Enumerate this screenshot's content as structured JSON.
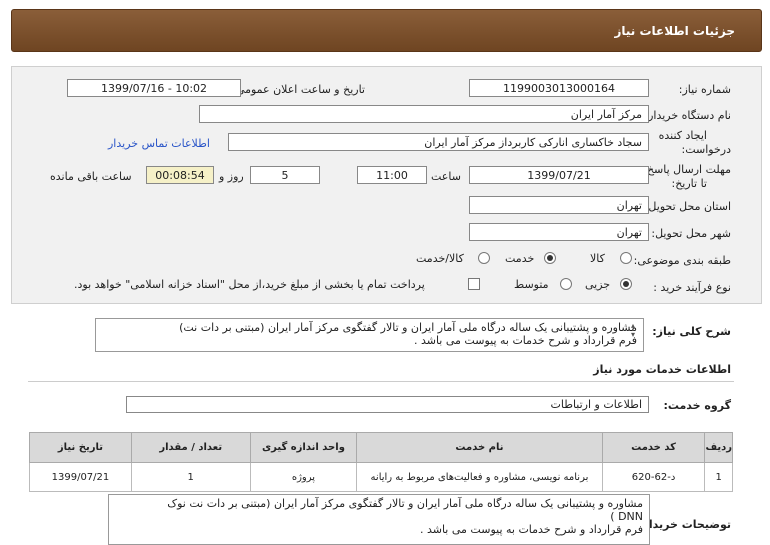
{
  "header": {
    "title": "جزئیات اطلاعات نیاز"
  },
  "form": {
    "need_number_label": "شماره نیاز:",
    "need_number": "1199003013000164",
    "announce_label": "تاریخ و ساعت اعلان عمومی:",
    "announce_value": "1399/07/16 - 10:02",
    "buyer_label": "نام دستگاه خریدار:",
    "buyer_value": "مرکز آمار ایران",
    "creator_label_1": "ایجاد کننده",
    "creator_label_2": "درخواست:",
    "creator_value": "سجاد خاکساری انارکی کاربرداز مرکز آمار ایران",
    "contact_link": "اطلاعات تماس خریدار",
    "deadline_label_1": "مهلت ارسال پاسخ:",
    "deadline_label_2": "تا تاریخ:",
    "deadline_date": "1399/07/21",
    "time_label": "ساعت",
    "deadline_time": "11:00",
    "days_value": "5",
    "days_label": "روز و",
    "remaining_value": "00:08:54",
    "remaining_label": "ساعت باقی مانده",
    "province_label": "استان محل تحویل:",
    "province_value": "تهران",
    "city_label": "شهر محل تحویل:",
    "city_value": "تهران",
    "category_label": "طبقه بندی موضوعی:",
    "category_options": [
      "کالا",
      "خدمت",
      "کالا/خدمت"
    ],
    "category_selected": "خدمت",
    "purchase_label": "نوع فرآیند خرید :",
    "purchase_options": [
      "جزیی",
      "متوسط"
    ],
    "purchase_selected": "جزیی",
    "payment_note": "پرداخت تمام یا بخشی از مبلغ خرید،از محل \"اسناد خزانه اسلامی\" خواهد بود."
  },
  "summary": {
    "label": "شرح کلی نیاز:",
    "line1": "مشاوره و پشتیبانی یک ساله درگاه ملی آمار ایران و تالار گفتگوی مرکز آمار ایران (مبتنی بر دات نت)",
    "line2": "فرم قرارداد و شرح خدمات به پیوست می باشد ."
  },
  "services": {
    "section_title": "اطلاعات خدمات مورد نیاز",
    "group_label": "گروه خدمت:",
    "group_value": "اطلاعات و ارتباطات",
    "columns": [
      "ردیف",
      "کد خدمت",
      "نام خدمت",
      "واحد اندازه گیری",
      "تعداد / مقدار",
      "تاریخ نیاز"
    ],
    "rows": [
      {
        "row": "1",
        "code": "د-62-620",
        "name": "برنامه نویسی، مشاوره و فعالیت‌های مربوط به رایانه",
        "unit": "پروژه",
        "qty": "1",
        "date": "1399/07/21"
      }
    ]
  },
  "buyer_notes": {
    "label": "توضیحات خریدار:",
    "line1": "مشاوره و پشتیبانی یک ساله درگاه ملی آمار ایران و تالار گفتگوی مرکز آمار ایران (مبتنی بر دات نت نوک",
    "line2": "DNN )",
    "line3": "فرم قرارداد و شرح خدمات به پیوست می باشد ."
  }
}
